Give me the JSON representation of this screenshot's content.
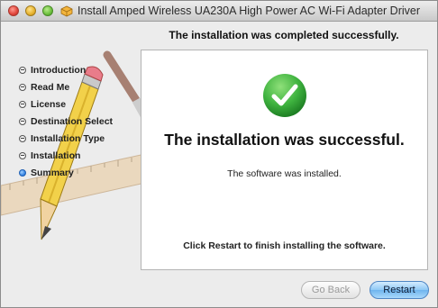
{
  "window": {
    "title": "Install Amped Wireless UA230A High Power AC Wi-Fi Adapter Driver",
    "header": "The installation was completed successfully."
  },
  "steps": [
    {
      "label": "Introduction",
      "active": false
    },
    {
      "label": "Read Me",
      "active": false
    },
    {
      "label": "License",
      "active": false
    },
    {
      "label": "Destination Select",
      "active": false
    },
    {
      "label": "Installation Type",
      "active": false
    },
    {
      "label": "Installation",
      "active": false
    },
    {
      "label": "Summary",
      "active": true
    }
  ],
  "content": {
    "status_icon": "success-check-icon",
    "headline": "The installation was successful.",
    "detail": "The software was installed.",
    "footer_note": "Click Restart to finish installing the software."
  },
  "buttons": {
    "go_back": "Go Back",
    "restart": "Restart"
  },
  "colors": {
    "success_green": "#3fb33f",
    "accent_blue": "#6fb4ee"
  }
}
